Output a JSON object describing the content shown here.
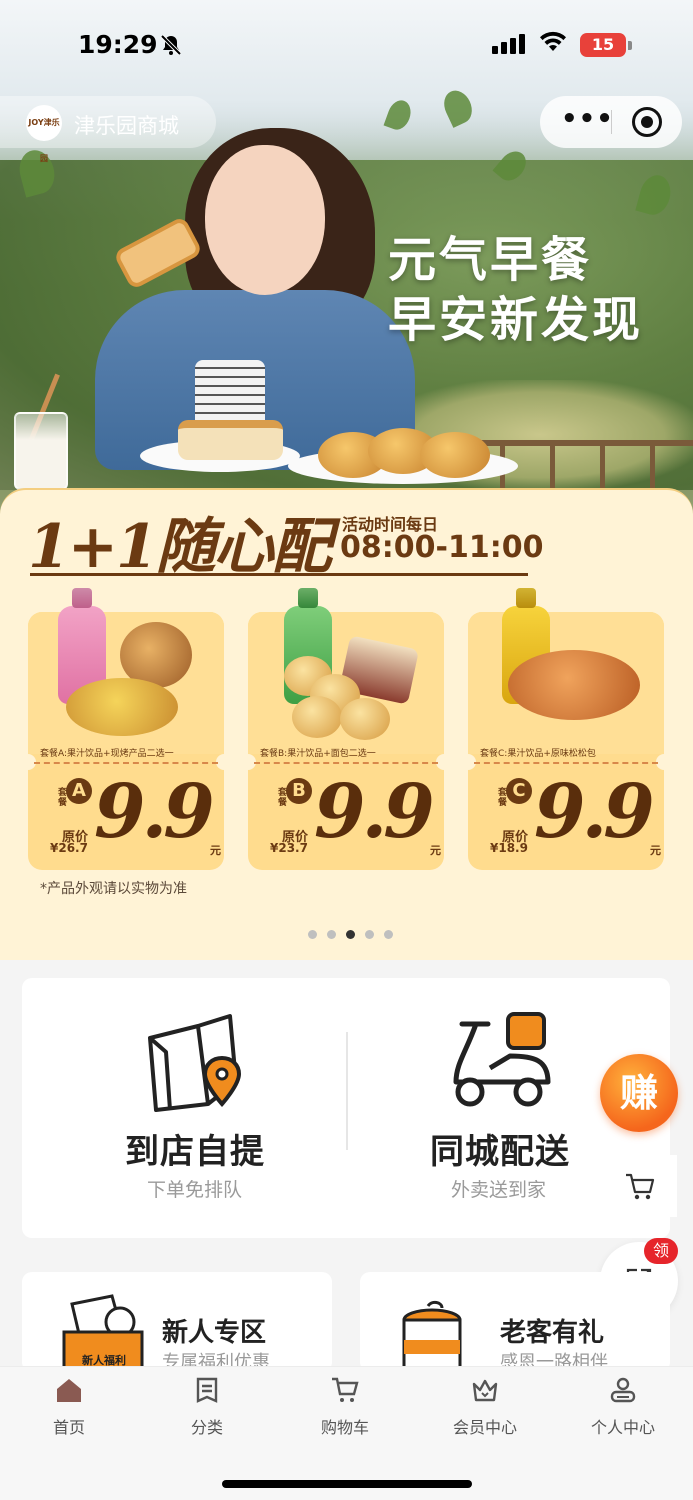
{
  "status_bar": {
    "time": "19:29",
    "battery": "15"
  },
  "header": {
    "shop_name": "津乐园商城",
    "logo_text": "JOY津乐园"
  },
  "banner": {
    "slogan_line1": "元气早餐",
    "slogan_line2": "早安新发现",
    "promo_title": "1+1随心配",
    "time_label": "活动时间每日",
    "time_range": "08:00-11:00",
    "note": "*产品外观请以实物为准",
    "carousel_dots": 5,
    "active_dot": 2,
    "combos": [
      {
        "desc": "套餐A:果汁饮品+现烤产品二选一",
        "tao": "套餐",
        "letter": "A",
        "orig_label": "原价",
        "orig_price": "¥26.7",
        "price": "9.9",
        "unit": "元"
      },
      {
        "desc": "套餐B:果汁饮品+面包二选一",
        "tao": "套餐",
        "letter": "B",
        "orig_label": "原价",
        "orig_price": "¥23.7",
        "price": "9.9",
        "unit": "元"
      },
      {
        "desc": "套餐C:果汁饮品+原味松松包",
        "tao": "套餐",
        "letter": "C",
        "orig_label": "原价",
        "orig_price": "¥18.9",
        "price": "9.9",
        "unit": "元"
      }
    ]
  },
  "services": {
    "pickup": {
      "title": "到店自提",
      "subtitle": "下单免排队"
    },
    "delivery": {
      "title": "同城配送",
      "subtitle": "外卖送到家"
    }
  },
  "floating": {
    "earn": "赚",
    "coupon_badge": "领"
  },
  "blocks": {
    "newcomer": {
      "title": "新人专区",
      "subtitle": "专属福利优惠",
      "tag": "新人福利"
    },
    "loyal": {
      "title": "老客有礼",
      "subtitle": "感恩一路相伴"
    }
  },
  "tabbar": [
    {
      "label": "首页"
    },
    {
      "label": "分类"
    },
    {
      "label": "购物车"
    },
    {
      "label": "会员中心"
    },
    {
      "label": "个人中心"
    }
  ],
  "colors": {
    "brand_brown": "#6b3a12",
    "promo_bg": "#fff3d6",
    "accent_orange": "#f5661c",
    "badge_red": "#e6252b"
  }
}
